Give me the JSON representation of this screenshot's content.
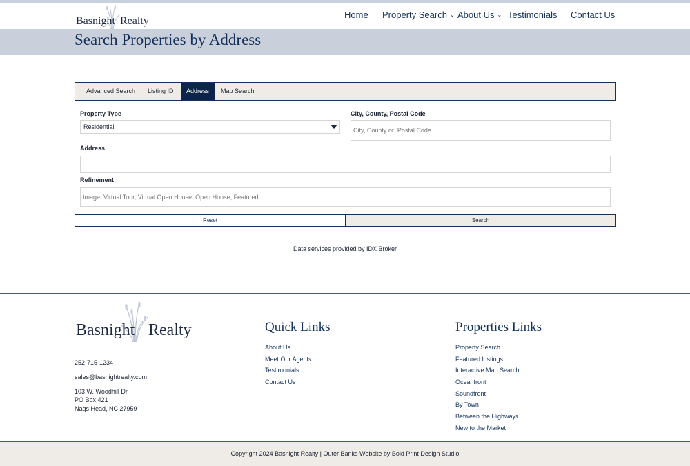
{
  "header": {
    "logo_word1": "Basnight",
    "logo_word2": "Realty",
    "nav": {
      "home": "Home",
      "property_search": "Property Search",
      "about_us": "About Us",
      "testimonials": "Testimonials",
      "contact_us": "Contact Us"
    },
    "caret": "⌄"
  },
  "banner": {
    "title": "Search Properties by Address"
  },
  "search": {
    "tabs": [
      "Advanced Search",
      "Listing ID",
      "Address",
      "Map Search"
    ],
    "active_tab": "Address",
    "property_type_label": "Property Type",
    "property_type_value": "Residential",
    "city_label": "City, County, Postal Code",
    "city_placeholder": "City, County or  Postal Code",
    "address_label": "Address",
    "address_value": "",
    "refinement_label": "Refinement",
    "refinement_placeholder": "Image, Virtual Tour, Virtual Open House, Open House, Featured",
    "reset_label": "Reset",
    "search_label": "Search",
    "idx_note": "Data services provided by IDX Broker"
  },
  "footer": {
    "logo_word1": "Basnight",
    "logo_word2": "Realty",
    "phone": "252-715-1234",
    "email": "sales@basnightrealty.com",
    "address_line1": "103 W. Woodhill Dr",
    "address_line2": "PO Box 421",
    "address_line3": "Nags Head, NC 27959",
    "quick_links_heading": "Quick Links",
    "quick_links": [
      "About Us",
      "Meet Our Agents",
      "Testimonials",
      "Contact Us"
    ],
    "properties_heading": "Properties Links",
    "properties_links": [
      "Property Search",
      "Featured Listings",
      "Interactive Map Search",
      "Oceanfront",
      "Soundfront",
      "By Town",
      "Between the Highways",
      "New to the Market"
    ],
    "copyright": "Copyright 2024 Basnight Realty | Outer Banks Website by Bold Print Design Studio"
  },
  "colors": {
    "navy": "#13315c",
    "active_tab": "#0b2447",
    "banner": "#c9cfdb",
    "beige": "#efebe7"
  }
}
